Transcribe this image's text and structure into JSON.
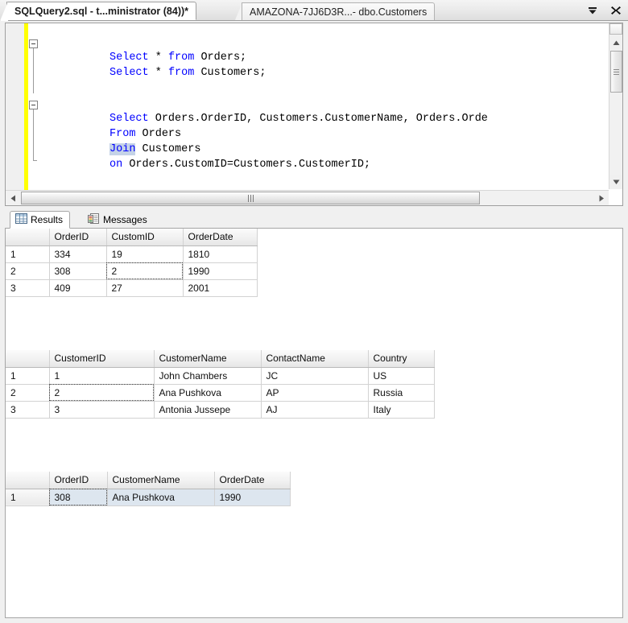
{
  "window": {
    "tabs": [
      {
        "label": "SQLQuery2.sql - t...ministrator (84))*",
        "active": true
      },
      {
        "label": "AMAZONA-7JJ6D3R...- dbo.Customers",
        "active": false
      }
    ],
    "controls": {
      "tab_list_label": "Tab list",
      "close_label": "Close"
    }
  },
  "editor": {
    "lines": [
      {
        "indent": 0,
        "segments": [
          {
            "t": "Select ",
            "k": "kw"
          },
          {
            "t": "* ",
            "k": "plain"
          },
          {
            "t": "from ",
            "k": "kw"
          },
          {
            "t": "Orders;",
            "k": "plain"
          }
        ]
      },
      {
        "indent": 0,
        "segments": [
          {
            "t": "Select ",
            "k": "kw"
          },
          {
            "t": "* ",
            "k": "plain"
          },
          {
            "t": "from ",
            "k": "kw"
          },
          {
            "t": "Customers;",
            "k": "plain"
          }
        ]
      },
      {
        "indent": 0,
        "segments": []
      },
      {
        "indent": 0,
        "segments": []
      },
      {
        "indent": 0,
        "segments": [
          {
            "t": "Select ",
            "k": "kw"
          },
          {
            "t": "Orders.OrderID, Customers.CustomerName, Orders.Orde",
            "k": "plain"
          }
        ]
      },
      {
        "indent": 0,
        "segments": [
          {
            "t": "From ",
            "k": "kw"
          },
          {
            "t": "Orders",
            "k": "plain"
          }
        ]
      },
      {
        "indent": 0,
        "segments": [
          {
            "t": "Join",
            "k": "kw-sel"
          },
          {
            "t": " Customers",
            "k": "plain"
          }
        ]
      },
      {
        "indent": 0,
        "segments": [
          {
            "t": "on ",
            "k": "kw"
          },
          {
            "t": "Orders.CustomID=Customers.CustomerID;",
            "k": "plain"
          }
        ]
      }
    ],
    "full_text_line5": "Select Orders.OrderID, Customers.CustomerName, Orders.OrderDate"
  },
  "results": {
    "tabs": [
      {
        "label": "Results",
        "icon": "grid-icon",
        "active": true
      },
      {
        "label": "Messages",
        "icon": "messages-icon",
        "active": false
      }
    ],
    "grids": [
      {
        "name": "orders-result",
        "columns": [
          "",
          "OrderID",
          "CustomID",
          "OrderDate"
        ],
        "widths": [
          54,
          71,
          95,
          92
        ],
        "rows": [
          {
            "num": "1",
            "cells": [
              "334",
              "19",
              "1810"
            ]
          },
          {
            "num": "2",
            "cells": [
              "308",
              "2",
              "1990"
            ],
            "selected_cell_index": 1
          },
          {
            "num": "3",
            "cells": [
              "409",
              "27",
              "2001"
            ]
          }
        ]
      },
      {
        "name": "customers-result",
        "columns": [
          "",
          "CustomerID",
          "CustomerName",
          "ContactName",
          "Country"
        ],
        "widths": [
          54,
          130,
          133,
          133,
          82
        ],
        "rows": [
          {
            "num": "1",
            "cells": [
              "1",
              "John Chambers",
              "JC",
              "US"
            ]
          },
          {
            "num": "2",
            "cells": [
              "2",
              "Ana Pushkova",
              "AP",
              "Russia"
            ],
            "selected_cell_index": 0
          },
          {
            "num": "3",
            "cells": [
              "3",
              "Antonia Jussepe",
              "AJ",
              "Italy"
            ]
          }
        ]
      },
      {
        "name": "join-result",
        "columns": [
          "",
          "OrderID",
          "CustomerName",
          "OrderDate"
        ],
        "widths": [
          54,
          72,
          133,
          94
        ],
        "rows": [
          {
            "num": "1",
            "cells": [
              "308",
              "Ana Pushkova",
              "1990"
            ],
            "row_selected": true,
            "focus_cell_index": 0
          }
        ]
      }
    ]
  },
  "colors": {
    "keyword": "#0000ff",
    "selection": "#c5d3e7",
    "change_bar": "#ffff00",
    "grid_selection": "#dde6ef",
    "header_bg": "#f1f1f1"
  }
}
